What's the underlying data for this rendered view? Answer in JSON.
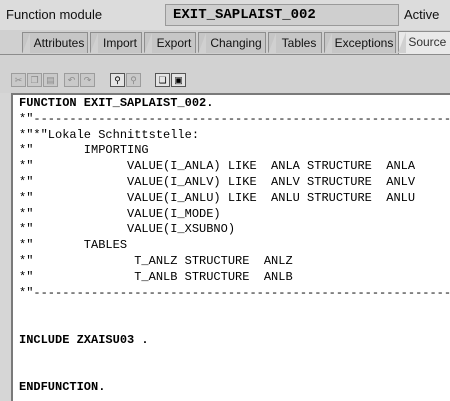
{
  "header": {
    "label": "Function module",
    "name": "EXIT_SAPLAIST_002",
    "status": "Active"
  },
  "tabs": [
    "Attributes",
    "Import",
    "Export",
    "Changing",
    "Tables",
    "Exceptions",
    "Source c"
  ],
  "toolbar": {
    "icons": [
      "cut-icon",
      "copy-icon",
      "paste-icon",
      "undo-icon",
      "redo-icon",
      "find-icon",
      "find-next-icon",
      "insert-icon",
      "pattern-icon"
    ]
  },
  "code_lines": [
    "FUNCTION EXIT_SAPLAIST_002.",
    "*\"----------------------------------------------------------------",
    "*\"*\"Lokale Schnittstelle:",
    "*\"       IMPORTING",
    "*\"             VALUE(I_ANLA) LIKE  ANLA STRUCTURE  ANLA",
    "*\"             VALUE(I_ANLV) LIKE  ANLV STRUCTURE  ANLV",
    "*\"             VALUE(I_ANLU) LIKE  ANLU STRUCTURE  ANLU",
    "*\"             VALUE(I_MODE)",
    "*\"             VALUE(I_XSUBNO)",
    "*\"       TABLES",
    "*\"              T_ANLZ STRUCTURE  ANLZ",
    "*\"              T_ANLB STRUCTURE  ANLB",
    "*\"----------------------------------------------------------------",
    "",
    "",
    "INCLUDE ZXAISU03 .",
    "",
    "",
    "ENDFUNCTION."
  ]
}
